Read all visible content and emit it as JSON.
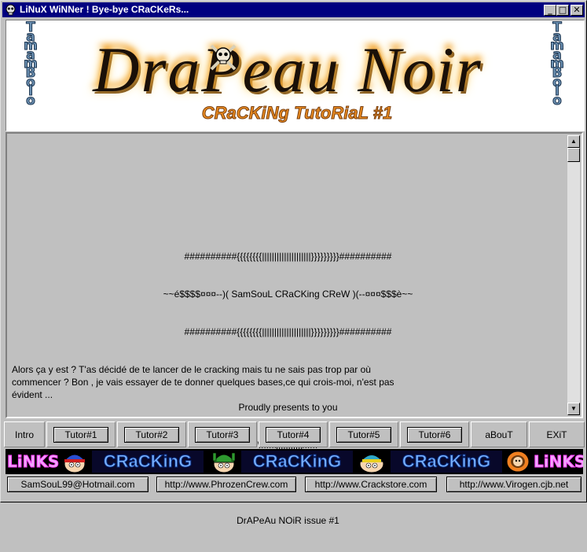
{
  "window": {
    "title": "LiNuX WiNNer ! Bye-bye CRaCKeRs...",
    "controls": {
      "minimize": "_",
      "maximize": "□",
      "close": "✕"
    }
  },
  "banner": {
    "side_text": [
      "T",
      "a",
      "m",
      "a",
      "m",
      "B",
      "o",
      "l",
      "o"
    ],
    "title": "DraPeau Noir",
    "subtitle": "CRaCKiNg TutoRiaL #1"
  },
  "content": {
    "center_lines": [
      "##########{{{{{{{{||||||||||||||||||||}}}}}}}}}##########",
      "~~é$$$$¤¤¤--)( SamSouL CRaCKing CReW )(--¤¤¤$$$è~~",
      "##########{{{{{{{{||||||||||||||||||||}}}}}}}}}##########",
      "",
      "Proudly presents to you",
      "\\\\\\\\\\\\\\|||||||||||//////",
      "",
      "DrAPeAu NOiR issue #1"
    ],
    "body_text": "Alors ça y est  ? T'as décidé  de  te  lancer  de le cracking mais tu ne sais pas trop par où commencer ? Bon , je  vais  essayer  de te  donner quelques bases,ce qui crois-moi, n'est pas évident ..."
  },
  "nav": {
    "intro": "Intro",
    "tutors": [
      "Tutor#1",
      "Tutor#2",
      "Tutor#3",
      "Tutor#4",
      "Tutor#5",
      "Tutor#6"
    ],
    "about": "aBouT",
    "exit": "EXiT"
  },
  "strip": {
    "links": "LiNKS",
    "cracking": "CRaCKinG"
  },
  "footer": {
    "links": [
      "SamSouL99@Hotmail.com",
      "http://www.PhrozenCrew.com",
      "http://www.Crackstore.com",
      "http://www.Virogen.cjb.net"
    ]
  },
  "colors": {
    "titlebar": "#000080",
    "face": "#c0c0c0"
  }
}
